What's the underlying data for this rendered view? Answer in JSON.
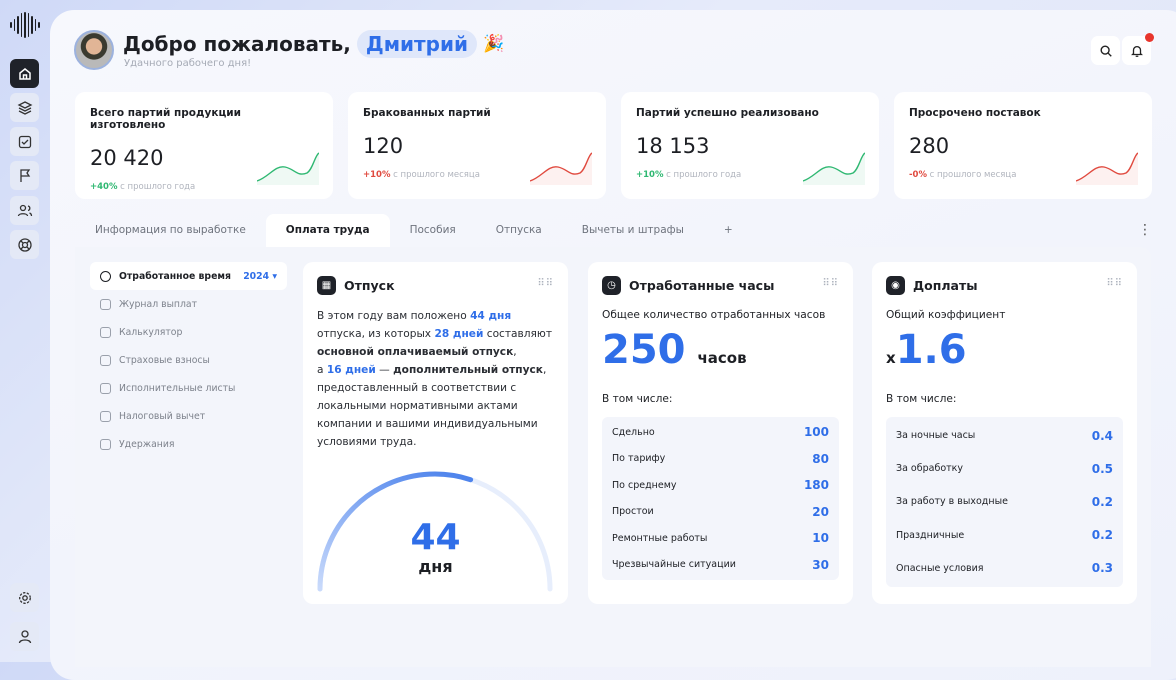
{
  "header": {
    "greeting": "Добро пожаловать,",
    "name": "Дмитрий",
    "emoji": "🎉",
    "subtitle": "Удачного рабочего дня!"
  },
  "stats": [
    {
      "title": "Всего партий продукции изготовлено",
      "value": "20 420",
      "delta": "+40%",
      "delta_note": "с прошлого года",
      "color": "#2fb872"
    },
    {
      "title": "Бракованных партий",
      "value": "120",
      "delta": "+10%",
      "delta_note": "с прошлого месяца",
      "color": "#e04a3f"
    },
    {
      "title": "Партий успешно реализовано",
      "value": "18 153",
      "delta": "+10%",
      "delta_note": "с прошлого года",
      "color": "#2fb872"
    },
    {
      "title": "Просрочено поставок",
      "value": "280",
      "delta": "-0%",
      "delta_note": "с прошлого месяца",
      "color": "#e04a3f"
    }
  ],
  "tabs": [
    "Информация по выработке",
    "Оплата труда",
    "Пособия",
    "Отпуска",
    "Вычеты и штрафы",
    "+"
  ],
  "menu": {
    "items": [
      "Отработанное время",
      "Журнал выплат",
      "Калькулятор",
      "Страховые взносы",
      "Исполнительные листы",
      "Налоговый вычет",
      "Удержания"
    ],
    "year": "2024"
  },
  "vacation": {
    "title": "Отпуск",
    "t1": "В этом году вам положено ",
    "d1": "44 дня",
    "t2": " отпуска, из которых ",
    "d2": "28 дней",
    "t3": " составляют ",
    "k1": "основной оплачиваемый отпуск",
    "t4": ",",
    "t5": "а ",
    "d3": "16 дней",
    "t6": " — ",
    "k2": "дополнительный отпуск",
    "t7": ",",
    "t8": "предоставленный в соответствии с локальными нормативными актами компании и вашими индивидуальными условиями труда.",
    "gauge_value": "44",
    "gauge_unit": "дня",
    "gauge_fraction": 0.6
  },
  "hours": {
    "title": "Отработанные часы",
    "label": "Общее количество отработанных часов",
    "value": "250",
    "unit": "часов",
    "incl": "В том числе:",
    "rows": [
      {
        "k": "Сдельно",
        "v": "100"
      },
      {
        "k": "По тарифу",
        "v": "80"
      },
      {
        "k": "По среднему",
        "v": "180"
      },
      {
        "k": "Простои",
        "v": "20"
      },
      {
        "k": "Ремонтные работы",
        "v": "10"
      },
      {
        "k": "Чрезвычайные ситуации",
        "v": "30"
      }
    ]
  },
  "extra": {
    "title": "Доплаты",
    "label": "Общий коэффициент",
    "prefix": "x",
    "value": "1.6",
    "incl": "В том числе:",
    "rows": [
      {
        "k": "За ночные часы",
        "v": "0.4"
      },
      {
        "k": "За обработку",
        "v": "0.5"
      },
      {
        "k": "За работу в выходные",
        "v": "0.2"
      },
      {
        "k": "Праздничные",
        "v": "0.2"
      },
      {
        "k": "Опасные условия",
        "v": "0.3"
      }
    ]
  }
}
